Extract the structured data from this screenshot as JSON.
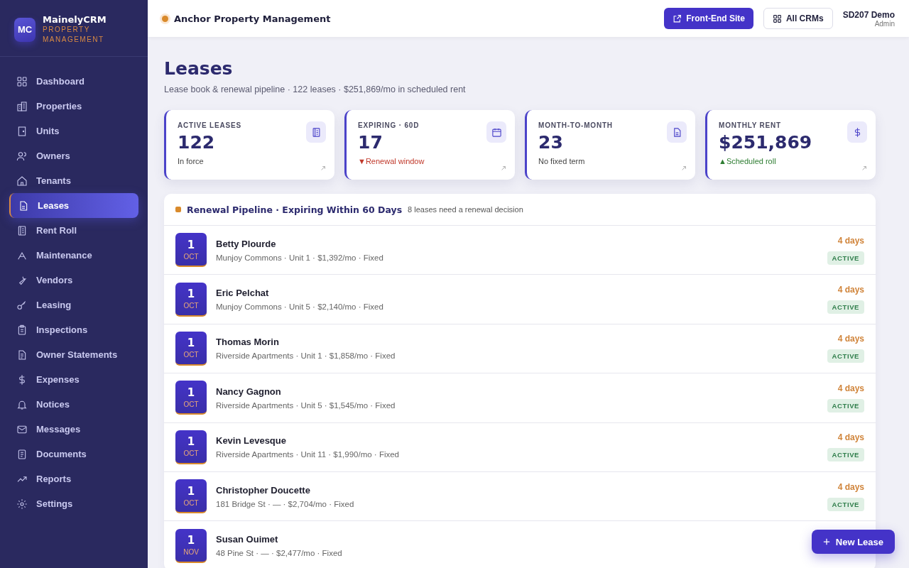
{
  "brand": {
    "logo": "MC",
    "name": "MainelyCRM",
    "tagline_1": "PROPERTY",
    "tagline_2": "MANAGEMENT"
  },
  "sidebar": {
    "items": [
      {
        "label": "Dashboard",
        "selected": false
      },
      {
        "label": "Properties",
        "selected": false
      },
      {
        "label": "Units",
        "selected": false
      },
      {
        "label": "Owners",
        "selected": false
      },
      {
        "label": "Tenants",
        "selected": false
      },
      {
        "label": "Leases",
        "selected": true
      },
      {
        "label": "Rent Roll",
        "selected": false
      },
      {
        "label": "Maintenance",
        "selected": false
      },
      {
        "label": "Vendors",
        "selected": false
      },
      {
        "label": "Leasing",
        "selected": false
      },
      {
        "label": "Inspections",
        "selected": false
      },
      {
        "label": "Owner Statements",
        "selected": false
      },
      {
        "label": "Expenses",
        "selected": false
      },
      {
        "label": "Notices",
        "selected": false
      },
      {
        "label": "Messages",
        "selected": false
      },
      {
        "label": "Documents",
        "selected": false
      },
      {
        "label": "Reports",
        "selected": false
      },
      {
        "label": "Settings",
        "selected": false
      }
    ]
  },
  "topbar": {
    "company": "Anchor Property Management",
    "buttons": [
      {
        "label": "Front-End Site",
        "kind": "primary"
      },
      {
        "label": "All CRMs",
        "kind": "secondary"
      }
    ],
    "user": {
      "name": "SD207 Demo",
      "role": "Admin"
    }
  },
  "page": {
    "title": "Leases",
    "subtitle": "Lease book & renewal pipeline · 122 leases · $251,869/mo in scheduled rent"
  },
  "stats": [
    {
      "label": "ACTIVE LEASES",
      "value": "122",
      "note": "In force",
      "color": "#444444"
    },
    {
      "label": "EXPIRING · 60D",
      "value": "17",
      "marker": "▼",
      "note": "Renewal window",
      "color": "#c0392b"
    },
    {
      "label": "MONTH-TO-MONTH",
      "value": "23",
      "note": "No fixed term",
      "color": "#444444"
    },
    {
      "label": "MONTHLY RENT",
      "value": "$251,869",
      "marker": "▲",
      "note": "Scheduled roll",
      "color": "#2e7d32"
    }
  ],
  "pipeline": {
    "title": "Renewal Pipeline · Expiring Within 60 Days",
    "note": "8 leases need a renewal decision",
    "rows": [
      {
        "day": "1",
        "month": "OCT",
        "name": "Betty Plourde",
        "detail": "Munjoy Commons · Unit 1 · $1,392/mo · Fixed",
        "days": "4 days",
        "status": "ACTIVE"
      },
      {
        "day": "1",
        "month": "OCT",
        "name": "Eric Pelchat",
        "detail": "Munjoy Commons · Unit 5 · $2,140/mo · Fixed",
        "days": "4 days",
        "status": "ACTIVE"
      },
      {
        "day": "1",
        "month": "OCT",
        "name": "Thomas Morin",
        "detail": "Riverside Apartments · Unit 1 · $1,858/mo · Fixed",
        "days": "4 days",
        "status": "ACTIVE"
      },
      {
        "day": "1",
        "month": "OCT",
        "name": "Nancy Gagnon",
        "detail": "Riverside Apartments · Unit 5 · $1,545/mo · Fixed",
        "days": "4 days",
        "status": "ACTIVE"
      },
      {
        "day": "1",
        "month": "OCT",
        "name": "Kevin Levesque",
        "detail": "Riverside Apartments · Unit 11 · $1,990/mo · Fixed",
        "days": "4 days",
        "status": "ACTIVE"
      },
      {
        "day": "1",
        "month": "OCT",
        "name": "Christopher Doucette",
        "detail": "181 Bridge St · — · $2,704/mo · Fixed",
        "days": "4 days",
        "status": "ACTIVE"
      },
      {
        "day": "1",
        "month": "NOV",
        "name": "Susan Ouimet",
        "detail": "48 Pine St · — · $2,477/mo · Fixed"
      }
    ]
  },
  "fab": {
    "label": "New Lease"
  }
}
